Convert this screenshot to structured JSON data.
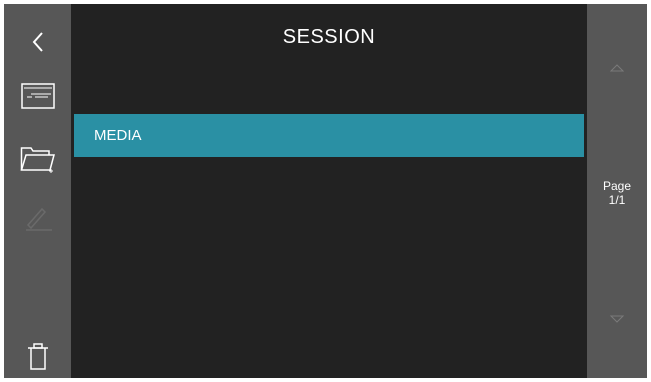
{
  "header": {
    "title": "SESSION"
  },
  "session_list": {
    "items": [
      {
        "label": "MEDIA"
      }
    ]
  },
  "pager": {
    "page_label": "Page",
    "page_value": "1/1"
  },
  "colors": {
    "sidebar_bg": "#575757",
    "content_bg": "#222222",
    "selected_row": "#2a90a4",
    "disabled_icon": "#6a6a6a"
  },
  "icons": {
    "back": "chevron-left-icon",
    "session_card": "card-icon",
    "new_folder": "folder-plus-icon",
    "rename": "pencil-icon",
    "delete": "trash-icon",
    "page_up": "triangle-up-icon",
    "page_down": "triangle-down-icon"
  }
}
